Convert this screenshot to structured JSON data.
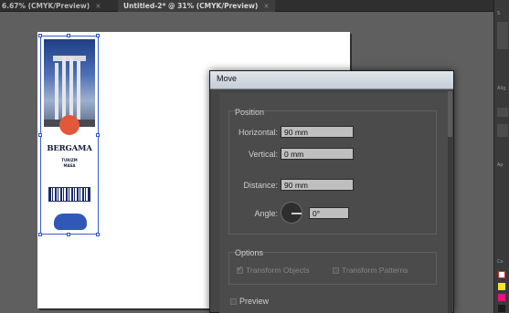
{
  "tabs": [
    {
      "label": "6.67% (CMYK/Preview)",
      "close": "×"
    },
    {
      "label": "Untitled-2* @ 31% (CMYK/Preview)",
      "close": "×"
    }
  ],
  "artwork": {
    "title": "BERGAMA",
    "line1": "TURIZM",
    "line2": "MASA"
  },
  "dialog": {
    "title": "Move",
    "position": {
      "heading": "Position",
      "horizontal_label": "Horizontal:",
      "horizontal_value": "90 mm",
      "vertical_label": "Vertical:",
      "vertical_value": "0 mm",
      "distance_label": "Distance:",
      "distance_value": "90 mm",
      "angle_label": "Angle:",
      "angle_value": "0°"
    },
    "options": {
      "heading": "Options",
      "transform_objects": "Transform Objects",
      "transform_objects_checked": true,
      "transform_patterns": "Transform Patterns",
      "transform_patterns_checked": false
    },
    "preview_label": "Preview",
    "preview_checked": false
  },
  "right_panel": {
    "label_top": "S",
    "label_mid": "Alig",
    "label_app": "Ap",
    "label_col": "Co"
  },
  "colors": {
    "canvas_bg": "#5f5f5f",
    "dialog_bg": "#454545",
    "selection": "#2d55d1",
    "field_bg": "#bfbfbf"
  }
}
